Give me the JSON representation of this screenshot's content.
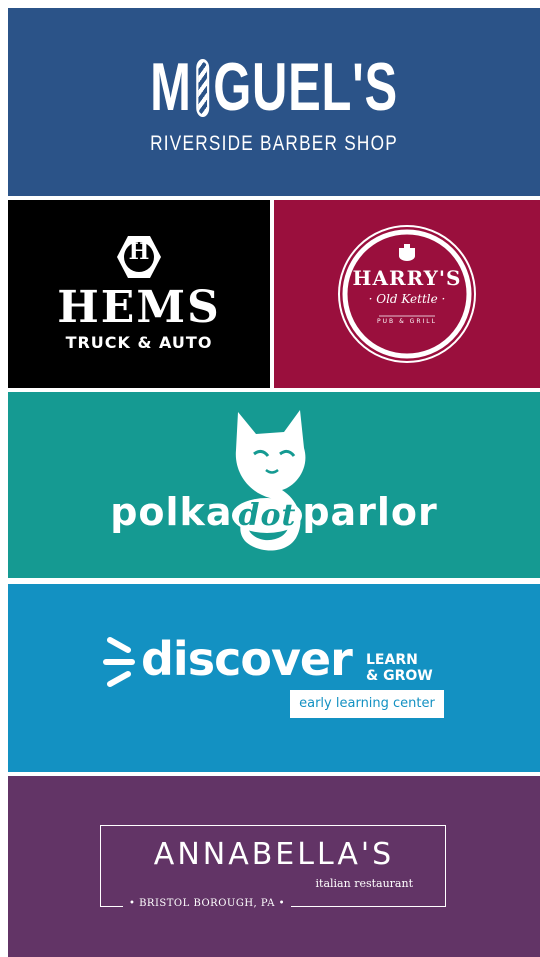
{
  "miguels": {
    "title_left": "M",
    "title_right": "GUEL'S",
    "subtitle": "RIVERSIDE BARBER SHOP",
    "background": "#2b5388",
    "icon": "barber-pole-icon"
  },
  "hems": {
    "hex_letter": "H",
    "title": "HEMS",
    "subtitle": "TRUCK & AUTO",
    "background": "#000000",
    "icon": "hexagon-icon"
  },
  "harrys": {
    "title": "HARRY'S",
    "script": "· Old Kettle ·",
    "tagline": "PUB & GRILL",
    "background": "#9a0f3d",
    "icon": "kettle-icon"
  },
  "polka": {
    "word1": "polka",
    "word2": "dot",
    "word3": "parlor",
    "background": "#159a92",
    "icon": "cat-icon"
  },
  "discover": {
    "main": "discover",
    "learn": "LEARN",
    "grow": "& GROW",
    "box": "early learning center",
    "background": "#1391c2",
    "icon": "sunrise-rays-icon"
  },
  "annabellas": {
    "title": "ANNABELLA'S",
    "subtitle": "italian restaurant",
    "location": "BRISTOL BOROUGH, PA",
    "background": "#623466"
  }
}
